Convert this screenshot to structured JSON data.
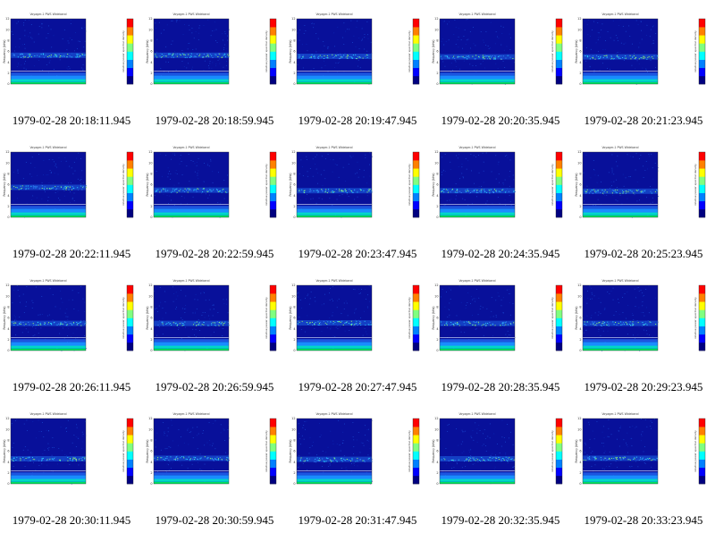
{
  "chart_data": {
    "type": "heatmap",
    "panel_title": "Voyager-1 PWS Wideband",
    "ylabel": "Frequency (kHz)",
    "colorbar_label": "relative power spectral density",
    "y_ticks": [
      "0",
      "2",
      "4",
      "6",
      "8",
      "10",
      "12"
    ],
    "ylim": [
      0,
      12
    ],
    "colormap": [
      "#000080",
      "#0000ff",
      "#0080ff",
      "#00ffff",
      "#80ff80",
      "#ffff00",
      "#ff8000",
      "#ff0000"
    ],
    "timestamps": [
      "1979-02-28 20:18:11.945",
      "1979-02-28 20:18:59.945",
      "1979-02-28 20:19:47.945",
      "1979-02-28 20:20:35.945",
      "1979-02-28 20:21:23.945",
      "1979-02-28 20:22:11.945",
      "1979-02-28 20:22:59.945",
      "1979-02-28 20:23:47.945",
      "1979-02-28 20:24:35.945",
      "1979-02-28 20:25:23.945",
      "1979-02-28 20:26:11.945",
      "1979-02-28 20:26:59.945",
      "1979-02-28 20:27:47.945",
      "1979-02-28 20:28:35.945",
      "1979-02-28 20:29:23.945",
      "1979-02-28 20:30:11.945",
      "1979-02-28 20:30:59.945",
      "1979-02-28 20:31:47.945",
      "1979-02-28 20:32:35.945",
      "1979-02-28 20:33:23.945"
    ],
    "emission_band_khz": [
      5.3,
      5.3,
      5.1,
      5.0,
      5.0,
      5.5,
      5.0,
      4.9,
      4.9,
      4.8,
      5.0,
      5.0,
      5.1,
      5.0,
      5.0,
      4.6,
      4.7,
      4.5,
      4.6,
      4.7
    ],
    "grid": false
  }
}
